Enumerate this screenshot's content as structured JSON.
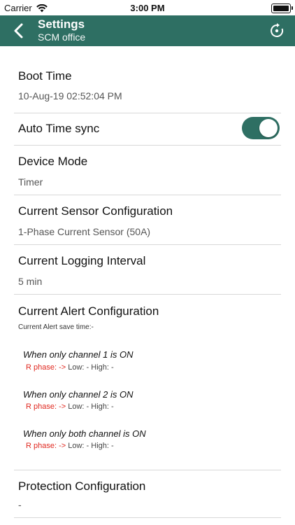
{
  "status_bar": {
    "carrier": "Carrier",
    "time": "3:00 PM"
  },
  "nav": {
    "title": "Settings",
    "subtitle": "SCM office"
  },
  "boot_time": {
    "label": "Boot Time",
    "value": "10-Aug-19 02:52:04 PM"
  },
  "auto_time_sync": {
    "label": "Auto Time sync",
    "enabled": true
  },
  "device_mode": {
    "label": "Device Mode",
    "value": "Timer"
  },
  "current_sensor": {
    "label": "Current Sensor Configuration",
    "value": "1-Phase Current Sensor (50A)"
  },
  "logging_interval": {
    "label": "Current Logging Interval",
    "value": "5 min"
  },
  "alert_config": {
    "label": "Current Alert Configuration",
    "save_time": "Current Alert save time:-",
    "channels": [
      {
        "title": "When only channel 1 is ON",
        "phase": "R phase: ->",
        "range": "Low: - High: -"
      },
      {
        "title": "When only channel 2 is ON",
        "phase": "R phase: ->",
        "range": "Low: - High: -"
      },
      {
        "title": "When only both channel is ON",
        "phase": "R phase: ->",
        "range": "Low: - High: -"
      }
    ]
  },
  "protection_config": {
    "label": "Protection Configuration",
    "value": "-"
  },
  "colors": {
    "accent": "#2e6f63",
    "alert_red": "#e0281f"
  }
}
